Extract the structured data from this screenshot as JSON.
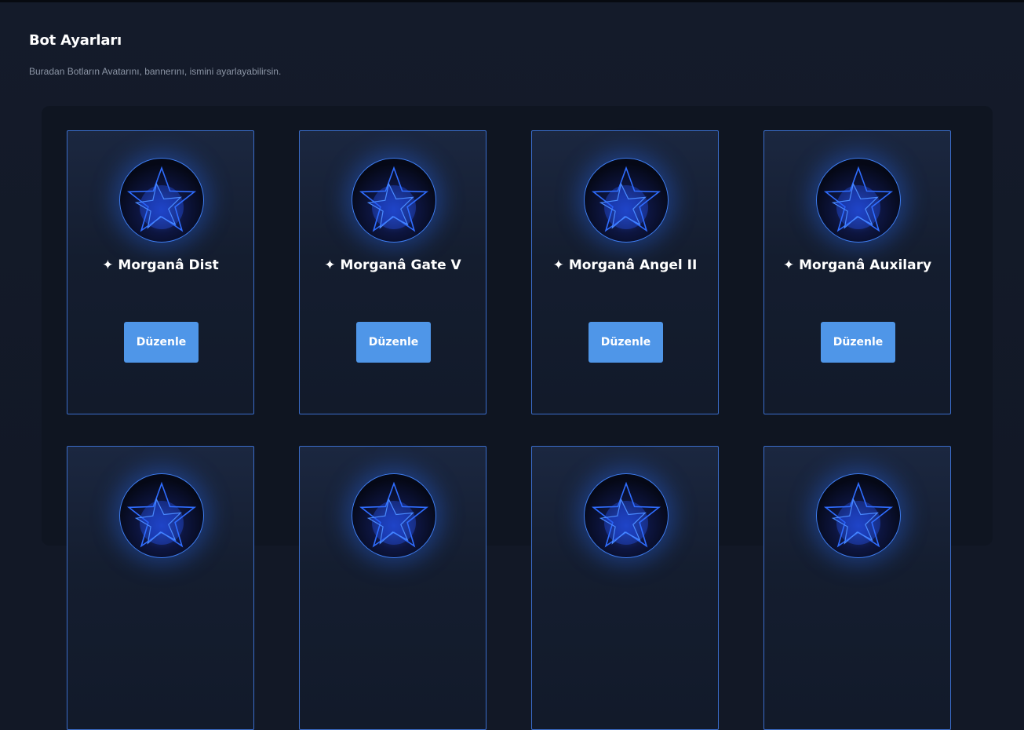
{
  "header": {
    "title": "Bot Ayarları",
    "subtitle": "Buradan Botların Avatarını, bannerını, ismini ayarlayabilirsin."
  },
  "bots": [
    {
      "name": "✦ Morganâ Dist",
      "button_label": "Düzenle"
    },
    {
      "name": "✦ Morganâ Gate V",
      "button_label": "Düzenle"
    },
    {
      "name": "✦ Morganâ Angel II",
      "button_label": "Düzenle"
    },
    {
      "name": "✦ Morganâ Auxilary",
      "button_label": "Düzenle"
    },
    {
      "name": "",
      "button_label": ""
    },
    {
      "name": "",
      "button_label": ""
    },
    {
      "name": "",
      "button_label": ""
    },
    {
      "name": "",
      "button_label": ""
    }
  ],
  "avatar_icon": "neon-star-icon",
  "colors": {
    "background": "#121826",
    "card_border": "#3a6cc9",
    "button": "#4f96e8",
    "text_muted": "#8c95a6"
  }
}
